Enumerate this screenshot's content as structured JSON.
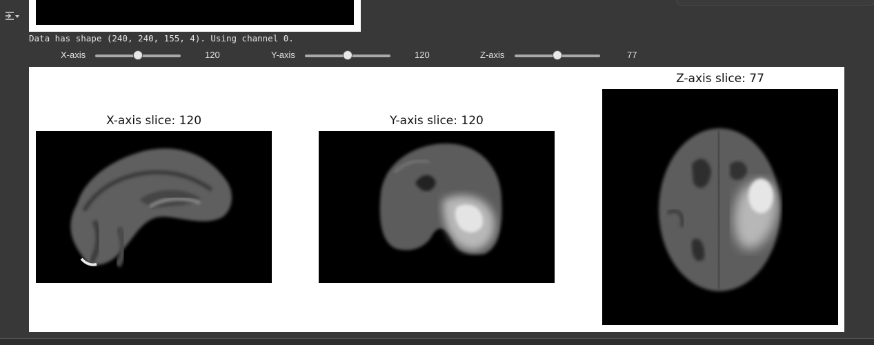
{
  "output": {
    "shape_message": "Data has shape (240, 240, 155, 4). Using channel 0."
  },
  "sliders": [
    {
      "label": "X-axis",
      "value": "120",
      "fraction": 0.5
    },
    {
      "label": "Y-axis",
      "value": "120",
      "fraction": 0.5
    },
    {
      "label": "Z-axis",
      "value": "77",
      "fraction": 0.5
    }
  ],
  "panels": [
    {
      "title": "X-axis slice: 120"
    },
    {
      "title": "Y-axis slice: 120"
    },
    {
      "title": "Z-axis slice: 77"
    }
  ],
  "icons": {
    "gutter": "output-toggle-icon"
  },
  "colors": {
    "background": "#383838",
    "figure_background": "#ffffff",
    "slider_track": "#a9a9a9"
  }
}
